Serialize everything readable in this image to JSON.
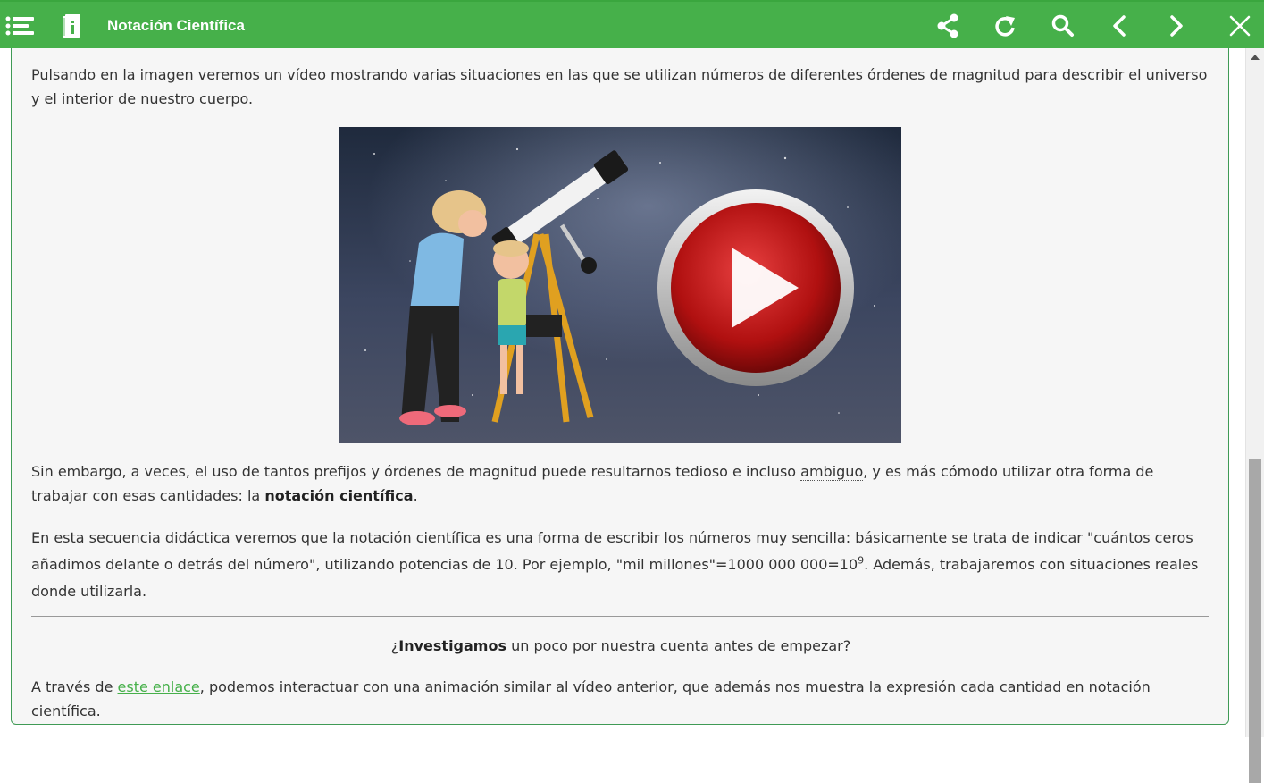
{
  "header": {
    "title": "Notación Científica",
    "icons": [
      "menu-icon",
      "book-info-icon",
      "share-icon",
      "refresh-icon",
      "search-icon",
      "previous-icon",
      "next-icon",
      "close-icon"
    ]
  },
  "colors": {
    "header_green": "#46b04a",
    "link_green": "#46b04a",
    "frame_border": "#3f9a55",
    "background": "#f6f6f6"
  },
  "content": {
    "intro": "Pulsando en la imagen veremos un vídeo mostrando varias situaciones en las que se utilizan números de diferentes órdenes de magnitud para describir el universo y el interior de nuestro cuerpo.",
    "para2_before": "Sin embargo, a veces, el uso de tantos prefijos y órdenes de magnitud puede resultarnos tedioso e incluso ",
    "para2_term": "ambiguo",
    "para2_middle": ", y es más cómodo utilizar otra forma de trabajar con esas cantidades: la ",
    "para2_bold": "notación científica",
    "para2_end": ".",
    "para3_before": "En esta secuencia didáctica veremos que la notación científica es una forma de escribir los números muy sencilla: básicamente se trata de indicar \"cuántos ceros añadimos delante o detrás del número\", utilizando potencias de 10. Por ejemplo, \"mil millones\"=1000 000 000=10",
    "para3_exponent": "9",
    "para3_after": ". Además, trabajaremos con situaciones reales donde utilizarla.",
    "question_open": "¿",
    "question_bold": "Investigamos",
    "question_rest": " un poco por nuestra cuenta antes de empezar?",
    "link_before": "A través de ",
    "link_text": "este enlace",
    "link_after": ", podemos interactuar con una animación similar al vídeo anterior, que además nos muestra la expresión cada cantidad en notación científica."
  },
  "video": {
    "thumbnail": "cartoon woman and child with telescope under starry sky",
    "overlay_icon": "play-button-icon"
  }
}
